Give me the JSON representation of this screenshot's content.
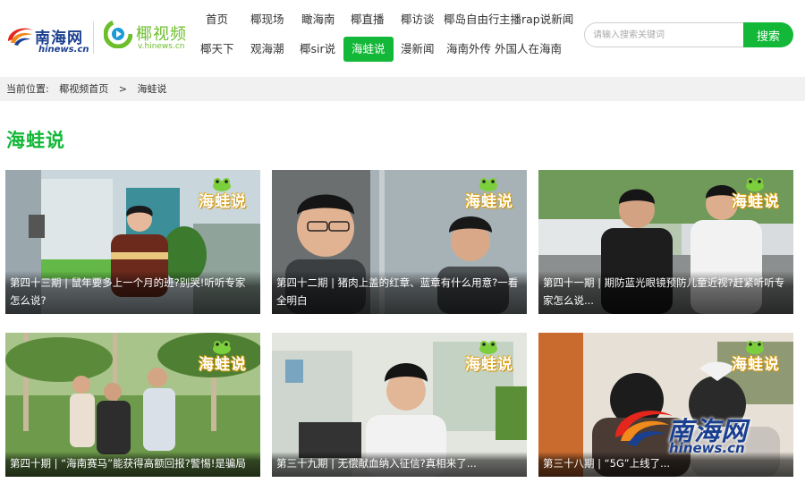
{
  "logos": {
    "hinews_cn": "南海网",
    "hinews_en": "hinews.cn",
    "ye_cn": "椰视频",
    "ye_en": "v.hinews.cn"
  },
  "nav": {
    "row1": [
      "首页",
      "椰现场",
      "瞰海南",
      "椰直播",
      "椰访谈",
      "椰岛自由行",
      "主播rap说新闻"
    ],
    "row2": [
      "椰天下",
      "观海潮",
      "椰sir说",
      "海蛙说",
      "漫新闻",
      "海南外传",
      "外国人在海南"
    ],
    "active": "海蛙说"
  },
  "search": {
    "placeholder": "请输入搜索关键词",
    "button_label": "搜索"
  },
  "breadcrumb": {
    "prefix": "当前位置:",
    "home": "椰视频首页",
    "separator": ">",
    "current": "海蛙说"
  },
  "page_title": "海蛙说",
  "badge_text": "海蛙说",
  "watermark": {
    "cn": "南海网",
    "en": "hinews.cn"
  },
  "colors": {
    "accent": "#13b838",
    "brand_blue": "#1a3f8f",
    "badge_yellow": "#f5c518"
  },
  "videos": [
    {
      "caption": "第四十三期 | 鼠年要多上一个月的班?别哭!听听专家怎么说?"
    },
    {
      "caption": "第四十二期 | 猪肉上盖的红章、蓝章有什么用意?一看全明白"
    },
    {
      "caption": "第四十一期 | 期防蓝光眼镜预防儿童近视?赶紧听听专家怎么说..."
    },
    {
      "caption": "第四十期 | “海南赛马”能获得高额回报?警惕!是骗局"
    },
    {
      "caption": "第三十九期 | 无偿献血纳入征信?真相来了..."
    },
    {
      "caption": "第三十八期 | “5G”上线了..."
    }
  ]
}
